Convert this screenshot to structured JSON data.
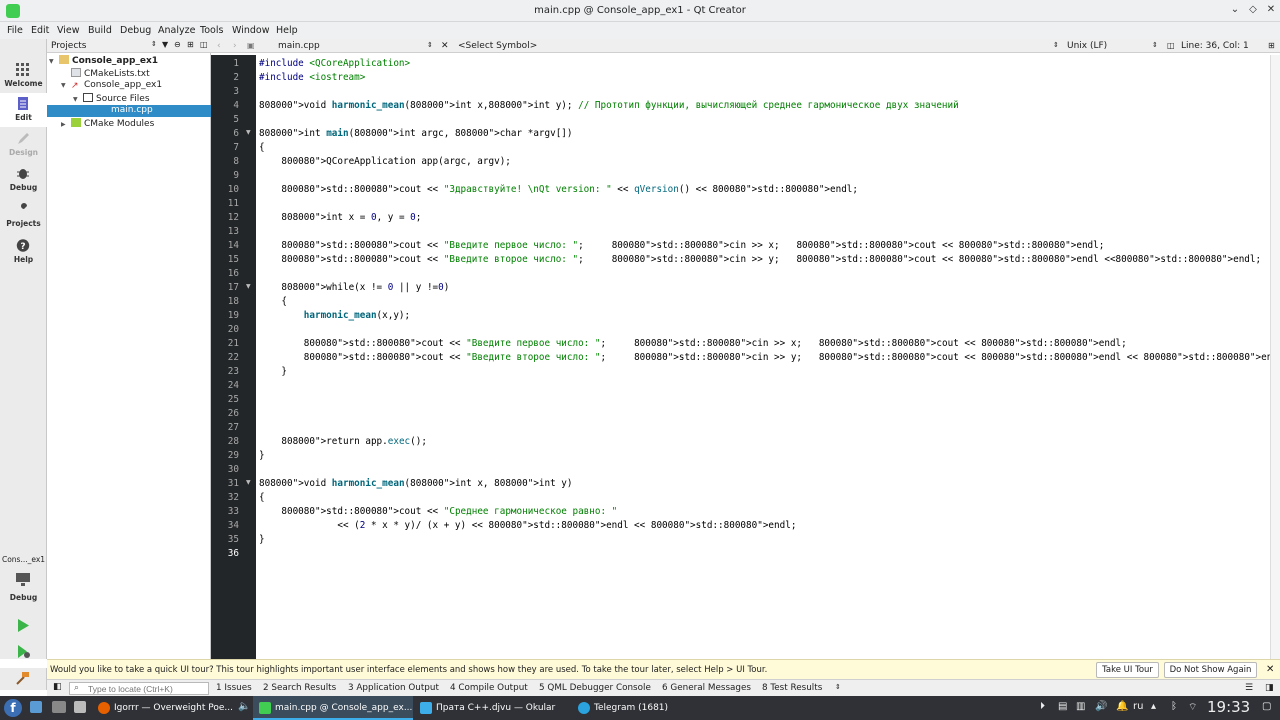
{
  "window": {
    "title": "main.cpp @ Console_app_ex1 - Qt Creator",
    "controls": [
      "⌄",
      "◇",
      "✕"
    ]
  },
  "menu": [
    "File",
    "Edit",
    "View",
    "Build",
    "Debug",
    "Analyze",
    "Tools",
    "Window",
    "Help"
  ],
  "modes": [
    {
      "label": "Welcome"
    },
    {
      "label": "Edit"
    },
    {
      "label": "Design"
    },
    {
      "label": "Debug"
    },
    {
      "label": "Projects"
    },
    {
      "label": "Help"
    }
  ],
  "kit": {
    "name": "Cons..._ex1",
    "config": "Debug"
  },
  "projects": {
    "header": "Projects",
    "tree": [
      {
        "label": "Console_app_ex1",
        "bold": true
      },
      {
        "label": "CMakeLists.txt"
      },
      {
        "label": "Console_app_ex1"
      },
      {
        "label": "Source Files"
      },
      {
        "label": "main.cpp",
        "selected": true
      },
      {
        "label": "CMake Modules"
      }
    ]
  },
  "editor": {
    "file": "main.cpp",
    "symbol": "<Select Symbol>",
    "encoding": "Unix (LF)",
    "position": "Line: 36, Col: 1",
    "lines": [
      "#include <QCoreApplication>",
      "#include <iostream>",
      "",
      "void harmonic_mean(int x,int y); // Прототип функции, вычисляющей среднее гармоническое двух значений",
      "",
      "int main(int argc, char *argv[])",
      "{",
      "    QCoreApplication app(argc, argv);",
      "",
      "    std::cout << \"Здравствуйте! \\nQt version: \" << qVersion() << std::endl;",
      "",
      "    int x = 0, y = 0;",
      "",
      "    std::cout << \"Введите первое число: \";     std::cin >> x;   std::cout << std::endl;",
      "    std::cout << \"Введите второе число: \";     std::cin >> y;   std::cout << std::endl <<std::endl;",
      "",
      "    while(x != 0 || y !=0)",
      "    {",
      "        harmonic_mean(x,y);",
      "",
      "        std::cout << \"Введите первое число: \";     std::cin >> x;   std::cout << std::endl;",
      "        std::cout << \"Введите второе число: \";     std::cin >> y;   std::cout << std::endl << std::endl;",
      "    }",
      "",
      "",
      "",
      "",
      "    return app.exec();",
      "}",
      "",
      "void harmonic_mean(int x, int y)",
      "{",
      "    std::cout << \"Среднее гармоническое равно: \"",
      "              << (2 * x * y)/ (x + y) << std::endl << std::endl;",
      "}",
      ""
    ]
  },
  "info": {
    "message": "Would you like to take a quick UI tour? This tour highlights important user interface elements and shows how they are used. To take the tour later, select Help > UI Tour.",
    "take": "Take UI Tour",
    "dismiss": "Do Not Show Again"
  },
  "status": {
    "locator_placeholder": "Type to locate (Ctrl+K)",
    "tabs": [
      "1  Issues",
      "2  Search Results",
      "3  Application Output",
      "4  Compile Output",
      "5  QML Debugger Console",
      "6  General Messages",
      "8  Test Results"
    ]
  },
  "taskbar": {
    "apps": [
      {
        "label": "Igorrr — Overweight Poe...",
        "color": "#e66000"
      },
      {
        "label": "main.cpp @ Console_app_ex...",
        "color": "#41cd52"
      },
      {
        "label": "Прата C++.djvu  — Okular",
        "color": "#3daee9"
      },
      {
        "label": "Telegram (1681)",
        "color": "#2aa3df"
      }
    ],
    "lang": "ru",
    "time": "19:33"
  }
}
